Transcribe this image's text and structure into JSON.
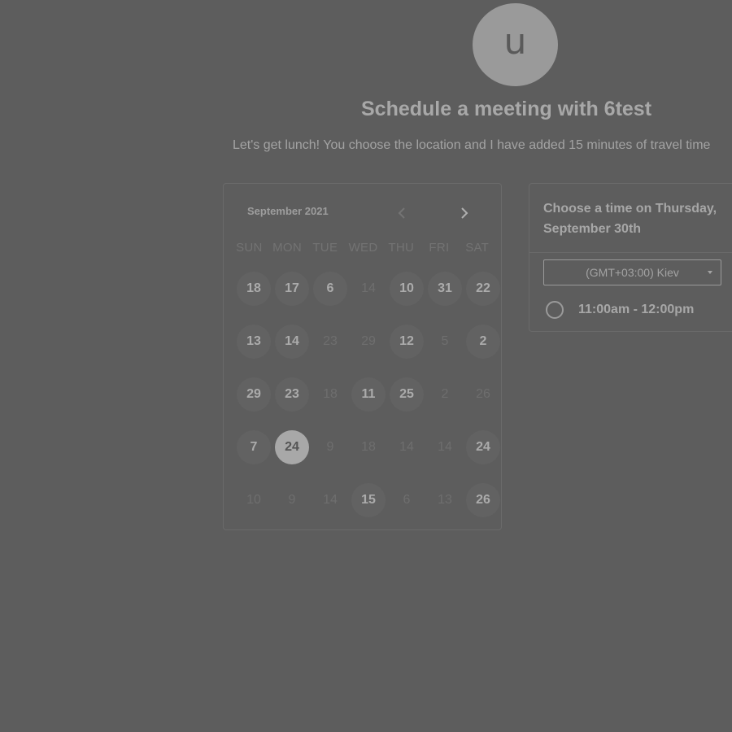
{
  "avatar": {
    "initial": "u"
  },
  "header": {
    "title": "Schedule a meeting with 6test",
    "subtitle": "Let's get lunch! You choose the location and I have added 15 minutes of travel time"
  },
  "calendar": {
    "month": "September 2021",
    "prev_icon": "chevron-left-icon",
    "next_icon": "chevron-right-icon",
    "weekdays": [
      "SUN",
      "MON",
      "TUE",
      "WED",
      "THU",
      "FRI",
      "SAT"
    ],
    "weeks": [
      [
        {
          "d": "18",
          "s": "available"
        },
        {
          "d": "17",
          "s": "available"
        },
        {
          "d": "6",
          "s": "available"
        },
        {
          "d": "14",
          "s": "disabled"
        },
        {
          "d": "10",
          "s": "available"
        },
        {
          "d": "31",
          "s": "available"
        },
        {
          "d": "22",
          "s": "available"
        }
      ],
      [
        {
          "d": "13",
          "s": "available"
        },
        {
          "d": "14",
          "s": "available"
        },
        {
          "d": "23",
          "s": "disabled"
        },
        {
          "d": "29",
          "s": "disabled"
        },
        {
          "d": "12",
          "s": "available"
        },
        {
          "d": "5",
          "s": "disabled"
        },
        {
          "d": "2",
          "s": "available"
        }
      ],
      [
        {
          "d": "29",
          "s": "available"
        },
        {
          "d": "23",
          "s": "available"
        },
        {
          "d": "18",
          "s": "disabled"
        },
        {
          "d": "11",
          "s": "available"
        },
        {
          "d": "25",
          "s": "available"
        },
        {
          "d": "2",
          "s": "disabled"
        },
        {
          "d": "26",
          "s": "disabled"
        }
      ],
      [
        {
          "d": "7",
          "s": "available"
        },
        {
          "d": "24",
          "s": "selected"
        },
        {
          "d": "9",
          "s": "disabled"
        },
        {
          "d": "18",
          "s": "disabled"
        },
        {
          "d": "14",
          "s": "disabled"
        },
        {
          "d": "14",
          "s": "disabled"
        },
        {
          "d": "24",
          "s": "available"
        }
      ],
      [
        {
          "d": "10",
          "s": "disabled"
        },
        {
          "d": "9",
          "s": "disabled"
        },
        {
          "d": "14",
          "s": "disabled"
        },
        {
          "d": "15",
          "s": "available"
        },
        {
          "d": "6",
          "s": "disabled"
        },
        {
          "d": "13",
          "s": "disabled"
        },
        {
          "d": "26",
          "s": "available"
        }
      ]
    ]
  },
  "time_panel": {
    "heading": "Choose a time on Thursday, September 30th",
    "timezone": "(GMT+03:00) Kiev",
    "slots": [
      "11:00am - 12:00pm"
    ]
  },
  "colors": {
    "background": "#5d5d5d",
    "selected": "#a8a8a8"
  }
}
